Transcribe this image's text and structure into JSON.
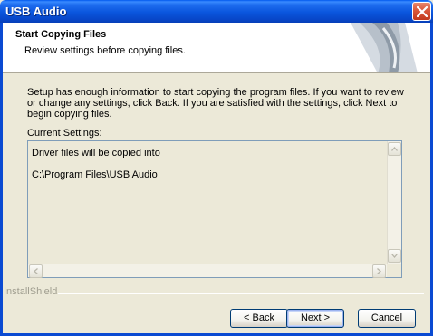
{
  "window": {
    "title": "USB Audio"
  },
  "header": {
    "title": "Start Copying Files",
    "subtitle": "Review settings before copying files."
  },
  "body": {
    "description": "Setup has enough information to start copying the program files.  If you want to review or change any settings, click Back.  If you are satisfied with the settings, click Next to begin copying files.",
    "current_settings_label": "Current Settings:",
    "settings_lines": [
      "Driver files will be copied into",
      "C:\\Program Files\\USB Audio"
    ]
  },
  "footer": {
    "brand": "InstallShield",
    "back_label": "< Back",
    "next_label": "Next >",
    "cancel_label": "Cancel"
  },
  "icons": [
    "close-icon",
    "wizard-graphic",
    "scroll-up-arrow-icon",
    "scroll-down-arrow-icon",
    "scroll-left-arrow-icon",
    "scroll-right-arrow-icon"
  ],
  "colors": {
    "titlebar": "#0a55dd",
    "close": "#d9573a",
    "dialog": "#ece9d8"
  }
}
